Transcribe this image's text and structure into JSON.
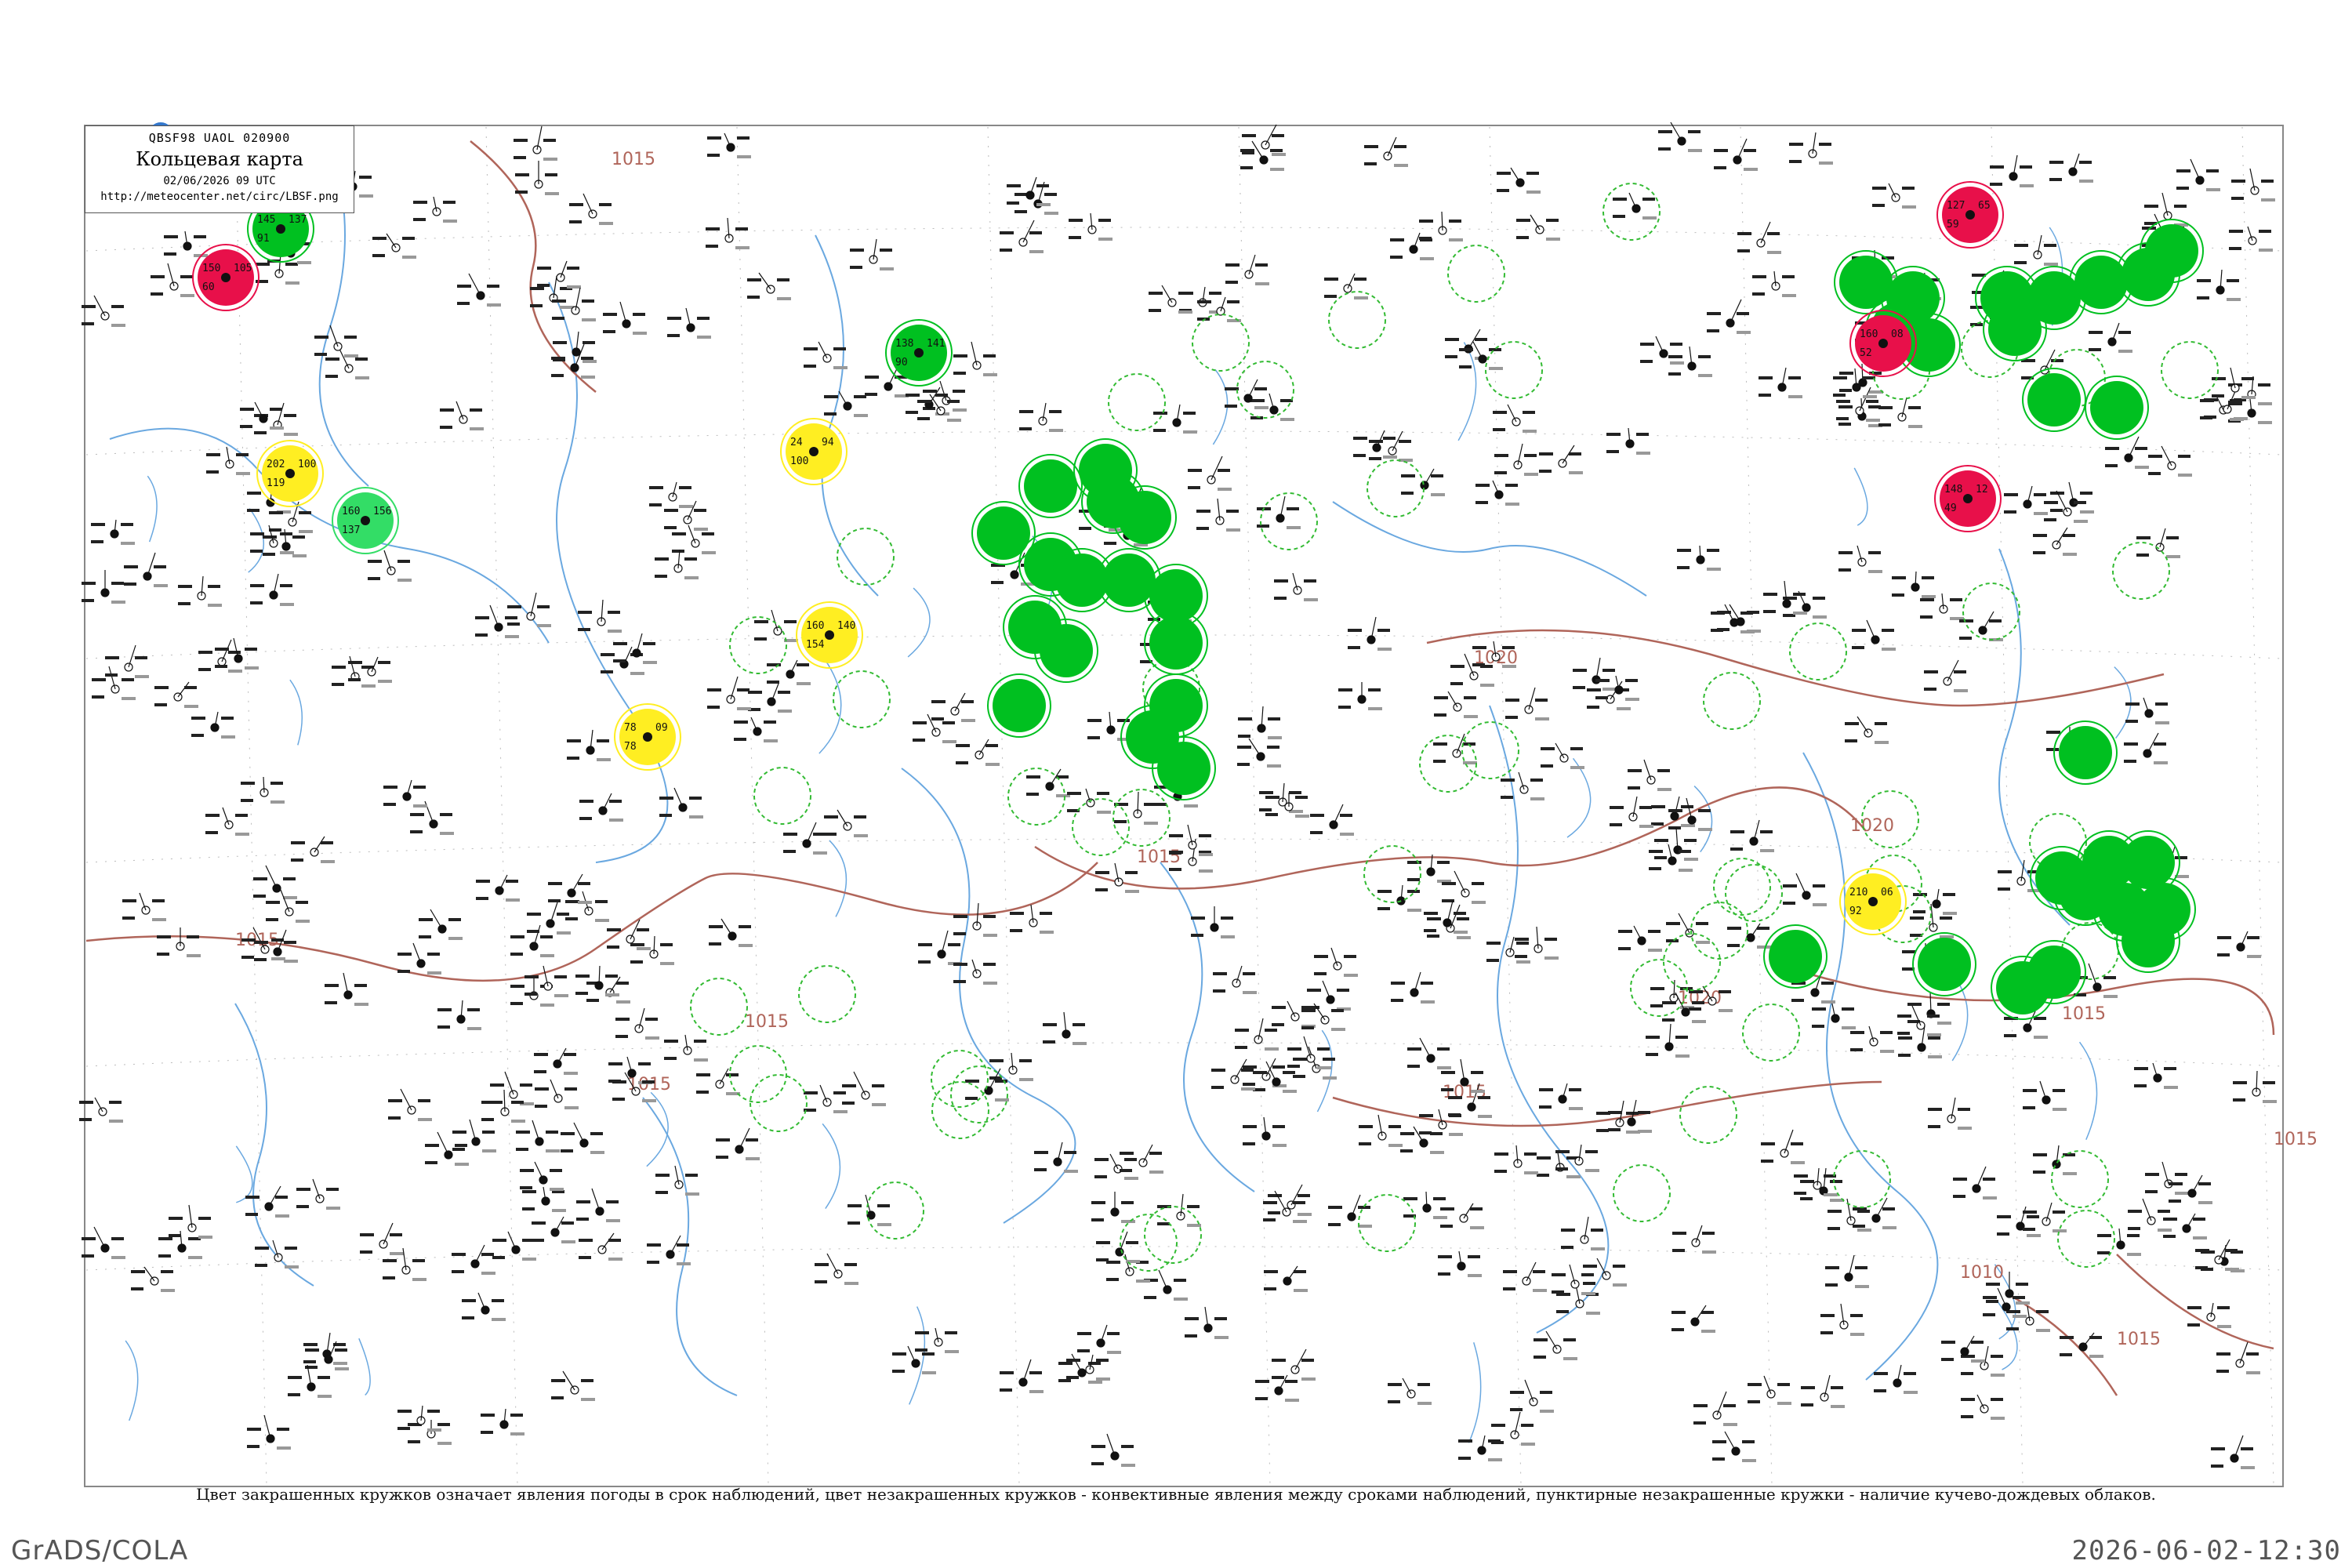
{
  "header": {
    "code": "QBSF98  UAOL  020900",
    "title": "Кольцевая карта",
    "datetime": "02/06/2026 09 UTC",
    "url": "http://meteocenter.net/circ/LBSF.png"
  },
  "caption": "Цвет закрашенных кружков означает явления погоды в срок наблюдений, цвет незакрашенных кружков - конвективные явления между сроками наблюдений, пунктирные незакрашенные кружки - наличие кучево-дождевых облаков.",
  "footer": {
    "software": "GrADS/COLA",
    "timestamp": "2026-06-02-12:30"
  },
  "isobars": {
    "color": "#b0655a",
    "labels": [
      "1015",
      "1015",
      "1015",
      "1015",
      "1015",
      "1015",
      "1015",
      "1015",
      "1020",
      "1020",
      "1020",
      "1010",
      "1015"
    ]
  },
  "legend_colors": {
    "rain": "#00c020",
    "shower": "#33dd66",
    "haze": "#ffee22",
    "thunderstorm": "#e8104a",
    "cb_ring": "#33bb33",
    "river": "#6aa8e0",
    "station_text": "#111111"
  },
  "stations": [
    {
      "name": "station-rain",
      "kind": "rain",
      "t": "145",
      "p": "137",
      "v": "91"
    },
    {
      "name": "station-thunder",
      "kind": "thunder",
      "t": "150",
      "p": "105",
      "v": "60"
    },
    {
      "name": "station-rain",
      "kind": "rain",
      "t": "138",
      "p": "141",
      "v": "90"
    },
    {
      "name": "station-haze",
      "kind": "haze",
      "t": "202",
      "p": "100",
      "v": "119"
    },
    {
      "name": "station-shower",
      "kind": "shower",
      "t": "160",
      "p": "156",
      "v": "137"
    },
    {
      "name": "station-haze",
      "kind": "haze",
      "t": "24",
      "p": "94",
      "v": "100"
    },
    {
      "name": "station-haze",
      "kind": "haze",
      "t": "160",
      "p": "140",
      "v": "154"
    },
    {
      "name": "station-haze",
      "kind": "haze",
      "t": "78",
      "p": "09",
      "v": "78"
    },
    {
      "name": "station-haze",
      "kind": "haze",
      "t": "210",
      "p": "06",
      "v": "92"
    },
    {
      "name": "station-thunder",
      "kind": "thunder",
      "t": "127",
      "p": "65",
      "v": "59"
    },
    {
      "name": "station-thunder",
      "kind": "thunder",
      "t": "148",
      "p": "12",
      "v": "49"
    },
    {
      "name": "station-thunder",
      "kind": "thunder",
      "t": "160",
      "p": "08",
      "v": "52"
    }
  ]
}
